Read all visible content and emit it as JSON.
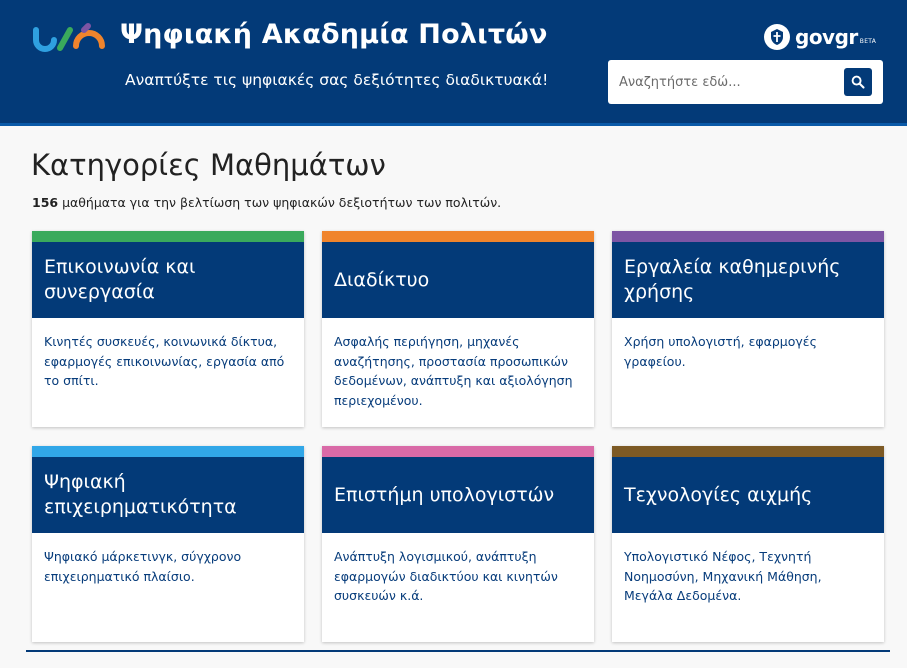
{
  "header": {
    "title": "Ψηφιακή Ακαδημία Πολιτών",
    "tagline": "Αναπτύξτε τις ψηφιακές σας δεξιότητες διαδικτυακά!",
    "logo_icon": "academy-logo-icon",
    "brand": {
      "wordmark": "govgr",
      "badge": "BETA",
      "icon": "greek-emblem-icon"
    },
    "search": {
      "placeholder": "Αναζητήστε εδώ...",
      "value": "",
      "icon": "search-icon"
    }
  },
  "main": {
    "title": "Κατηγορίες Μαθημάτων",
    "course_count": "156",
    "summary_text": " μαθήματα για την βελτίωση των ψηφιακών δεξιοτήτων των πολιτών."
  },
  "categories": [
    {
      "title": "Επικοινωνία και συνεργασία",
      "description": "Κινητές συσκευές, κοινωνικά δίκτυα, εφαρμογές επικοινωνίας, εργασία από το σπίτι.",
      "color": "#3aaa5c"
    },
    {
      "title": "Διαδίκτυο",
      "description": "Ασφαλής περιήγηση, μηχανές αναζήτησης, προστασία προσωπικών δεδομένων, ανάπτυξη και αξιολόγηση περιεχομένου.",
      "color": "#f0842c"
    },
    {
      "title": "Εργαλεία καθημερινής χρήσης",
      "description": "Χρήση υπολογιστή, εφαρμογές γραφείου.",
      "color": "#7d55a4"
    },
    {
      "title": "Ψηφιακή επιχειρηματικότητα",
      "description": "Ψηφιακό μάρκετινγκ, σύγχρονο επιχειρηματικό πλαίσιο.",
      "color": "#31a7e8"
    },
    {
      "title": "Επιστήμη υπολογιστών",
      "description": "Ανάπτυξη λογισμικού, ανάπτυξη εφαρμογών διαδικτύου και κινητών συσκευών κ.ά.",
      "color": "#d96aa7"
    },
    {
      "title": "Τεχνολογίες αιχμής",
      "description": "Υπολογιστικό Νέφος, Τεχνητή Νοημοσύνη,  Μηχανική Μάθηση, Μεγάλα Δεδομένα.",
      "color": "#7d5a25"
    }
  ],
  "colors": {
    "primary": "#033a78",
    "link_text": "#073c7b",
    "background": "#f8f8f8"
  }
}
